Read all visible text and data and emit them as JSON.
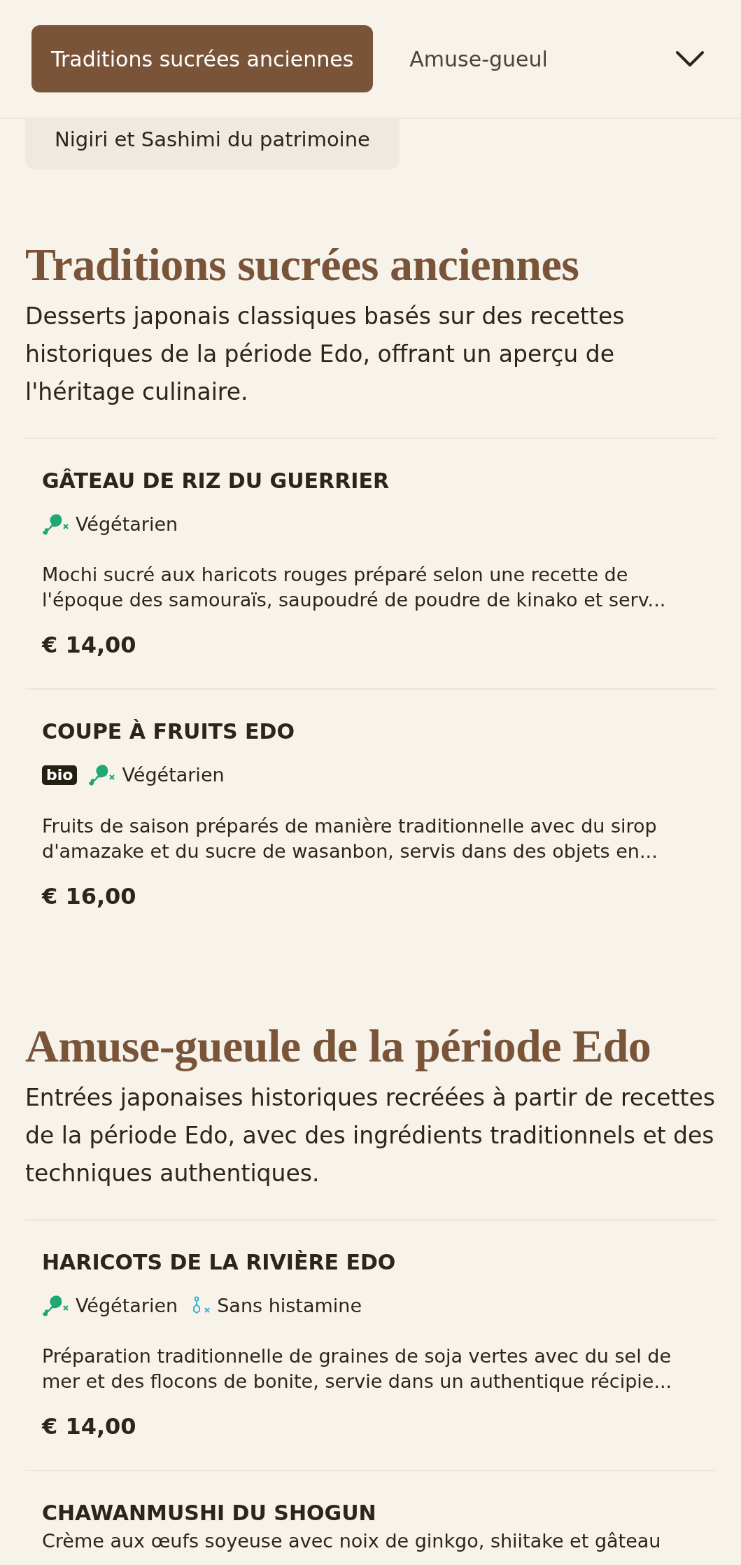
{
  "header": {
    "tabs": [
      {
        "label": "Traditions sucrées anciennes",
        "selected": true
      },
      {
        "label": "Amuse-gueul",
        "selected": false
      }
    ],
    "expanded": false
  },
  "category_list": [
    {
      "label": "Nigiri et Sashimi du patrimoine",
      "selected": false
    }
  ],
  "sections": [
    {
      "title": "Traditions sucrées anciennes",
      "description": "Desserts japonais classiques basés sur des recettes historiques de la période Edo, offrant un aperçu de l'héritage culinaire.",
      "items": [
        {
          "name": "GÂTEAU DE RIZ DU GUERRIER",
          "tags": [
            {
              "kind": "vegetarian",
              "label": "Végétarien"
            }
          ],
          "description": "Mochi sucré aux haricots rouges préparé selon une recette de l'époque des samouraïs, saupoudré de poudre de kinako et serv...",
          "price": "€ 14,00"
        },
        {
          "name": "COUPE À FRUITS EDO",
          "tags": [
            {
              "kind": "bio",
              "label": "bio"
            },
            {
              "kind": "vegetarian",
              "label": "Végétarien"
            }
          ],
          "description": "Fruits de saison préparés de manière traditionnelle avec du sirop d'amazake et du sucre de wasanbon, servis dans des objets en...",
          "price": "€ 16,00"
        }
      ]
    },
    {
      "title": "Amuse-gueule de la période Edo",
      "description": "Entrées japonaises historiques recréées à partir de recettes de la période Edo, avec des ingrédients traditionnels et des techniques authentiques.",
      "items": [
        {
          "name": "HARICOTS DE LA RIVIÈRE EDO",
          "tags": [
            {
              "kind": "vegetarian",
              "label": "Végétarien"
            },
            {
              "kind": "histamine-free",
              "label": "Sans histamine"
            }
          ],
          "description": "Préparation traditionnelle de graines de soja vertes avec du sel de mer et des flocons de bonite, servie dans un authentique récipie...",
          "price": "€ 14,00"
        },
        {
          "name": "CHAWANMUSHI DU SHOGUN",
          "description": "Crème aux œufs soyeuse avec noix de ginkgo, shiitake et gâteau"
        }
      ]
    }
  ]
}
